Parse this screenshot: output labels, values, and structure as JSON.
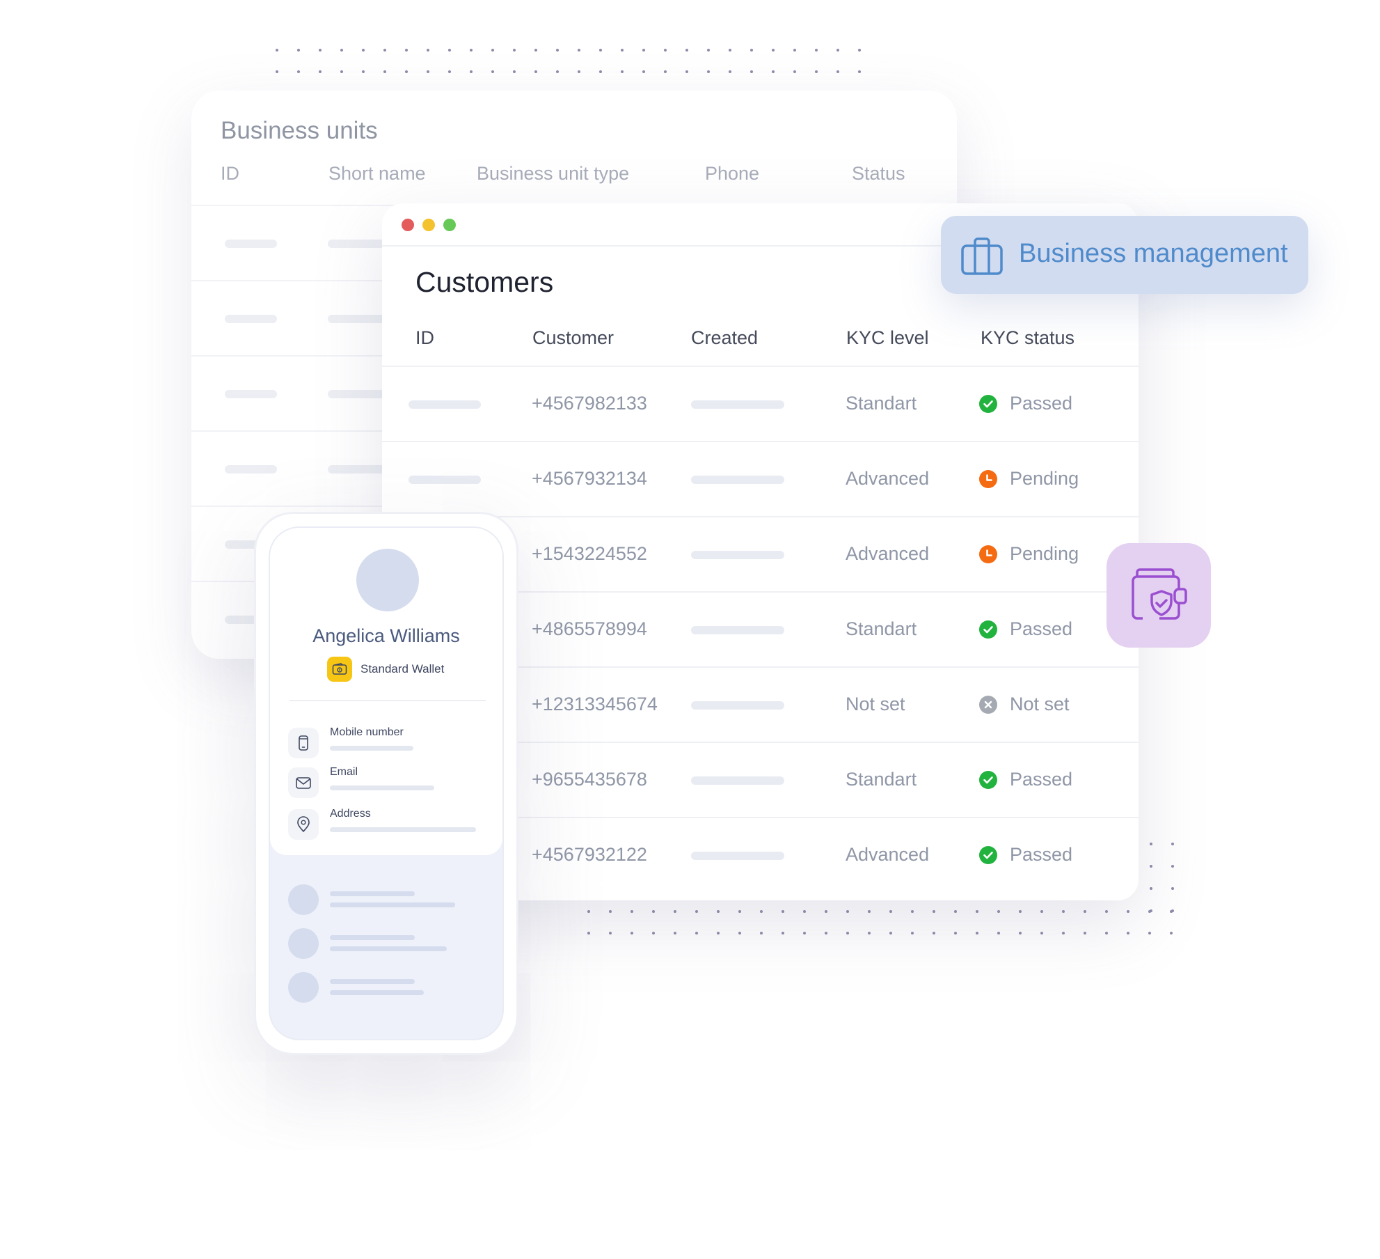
{
  "business_units": {
    "title": "Business units",
    "columns": [
      "ID",
      "Short name",
      "Business unit type",
      "Phone",
      "Status"
    ]
  },
  "customers": {
    "title": "Customers",
    "columns": [
      "ID",
      "Customer",
      "Created",
      "KYC level",
      "KYC status"
    ],
    "rows": [
      {
        "customer": "+4567982133",
        "kyc_level": "Standart",
        "kyc_status": "Passed",
        "status_kind": "passed"
      },
      {
        "customer": "+4567932134",
        "kyc_level": "Advanced",
        "kyc_status": "Pending",
        "status_kind": "pending"
      },
      {
        "customer": "+1543224552",
        "kyc_level": "Advanced",
        "kyc_status": "Pending",
        "status_kind": "pending"
      },
      {
        "customer": "+4865578994",
        "kyc_level": "Standart",
        "kyc_status": "Passed",
        "status_kind": "passed"
      },
      {
        "customer": "+12313345674",
        "kyc_level": "Not set",
        "kyc_status": "Not set",
        "status_kind": "notset"
      },
      {
        "customer": "+9655435678",
        "kyc_level": "Standart",
        "kyc_status": "Passed",
        "status_kind": "passed"
      },
      {
        "customer": "+4567932122",
        "kyc_level": "Advanced",
        "kyc_status": "Passed",
        "status_kind": "passed"
      }
    ]
  },
  "badge": {
    "label": "Business management",
    "icon": "briefcase-icon"
  },
  "feature_tile": {
    "icon": "wallet-shield-icon"
  },
  "profile": {
    "name": "Angelica Williams",
    "wallet": "Standard Wallet",
    "fields": [
      {
        "label": "Mobile number",
        "icon": "phone-icon"
      },
      {
        "label": "Email",
        "icon": "mail-icon"
      },
      {
        "label": "Address",
        "icon": "location-pin-icon"
      }
    ]
  },
  "colors": {
    "passed": "#22b33f",
    "pending": "#f46b12",
    "notset": "#a5a9b2",
    "badge_bg": "#d2dcf0",
    "badge_text": "#4f8acb",
    "tile_bg": "#e4d0f1",
    "tile_icon": "#9a4fd0",
    "wallet_yellow": "#f7c615",
    "traffic_red": "#e45b5b",
    "traffic_yellow": "#f4c22e",
    "traffic_green": "#66c957"
  }
}
